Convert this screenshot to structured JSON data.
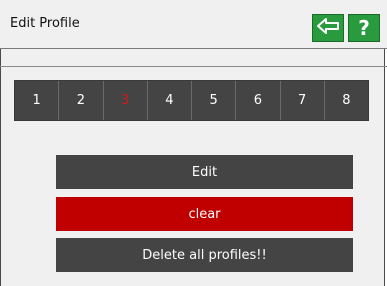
{
  "header": {
    "title": "Edit Profile",
    "back_icon": "arrow-left-icon",
    "help_label": "?"
  },
  "tabs": [
    {
      "label": "1",
      "selected": false
    },
    {
      "label": "2",
      "selected": false
    },
    {
      "label": "3",
      "selected": true
    },
    {
      "label": "4",
      "selected": false
    },
    {
      "label": "5",
      "selected": false
    },
    {
      "label": "6",
      "selected": false
    },
    {
      "label": "7",
      "selected": false
    },
    {
      "label": "8",
      "selected": false
    }
  ],
  "actions": {
    "edit_label": "Edit",
    "clear_label": "clear",
    "delete_all_label": "Delete all profiles!!"
  },
  "colors": {
    "accent_green": "#2a9a3e",
    "danger_red": "#c00000",
    "selected_tab_text": "#d11a1a",
    "dark_button": "#444444"
  }
}
